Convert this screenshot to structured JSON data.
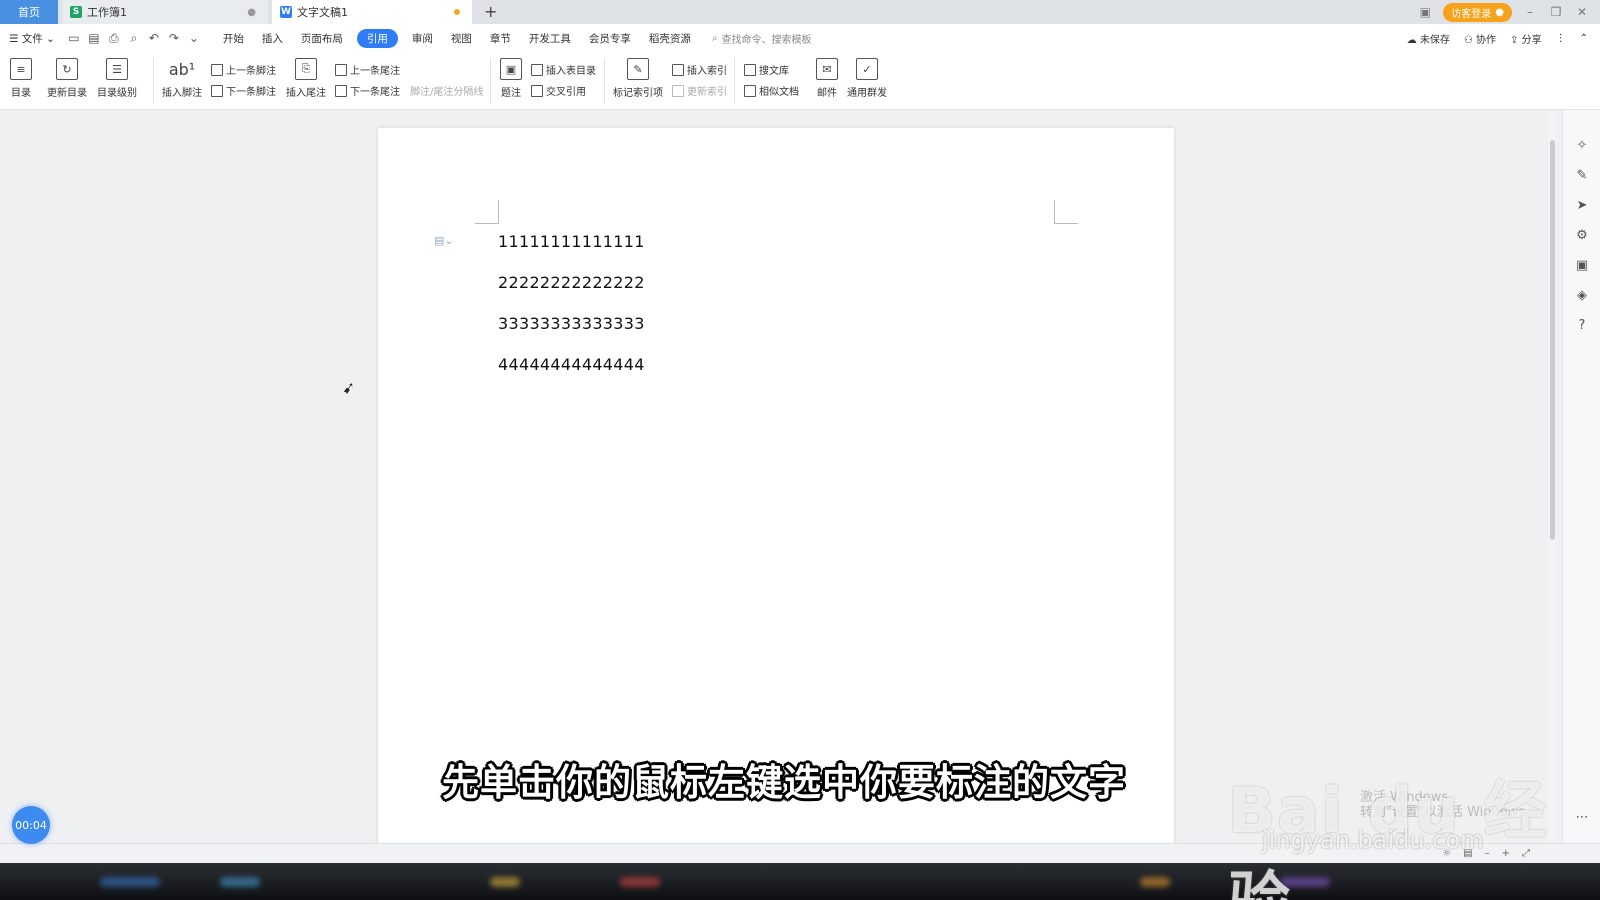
{
  "tabs": {
    "home": "首页",
    "workbook": "工作簿1",
    "document": "文字文稿1"
  },
  "topbar": {
    "login": "访客登录"
  },
  "menu": {
    "file": "文件",
    "items": [
      "开始",
      "插入",
      "页面布局",
      "引用",
      "审阅",
      "视图",
      "章节",
      "开发工具",
      "会员专享",
      "稻壳资源"
    ],
    "active": "引用",
    "search_placeholder": "查找命令、搜索模板",
    "unsaved": "未保存",
    "collab": "协作",
    "share": "分享"
  },
  "ribbon": {
    "toc": "目录",
    "update_toc": "更新目录",
    "toc_level": "目录级别",
    "insert_footnote": "插入脚注",
    "prev_footnote": "上一条脚注",
    "next_footnote": "下一条脚注",
    "insert_endnote": "插入尾注",
    "prev_endnote": "上一条尾注",
    "next_endnote": "下一条尾注",
    "separator": "脚注/尾注分隔线",
    "caption": "题注",
    "insert_table_toc": "插入表目录",
    "cross_ref": "交叉引用",
    "mark_index": "标记索引项",
    "insert_index": "插入索引",
    "update_index": "更新索引",
    "search_lib": "搜文库",
    "similar_docs": "相似文档",
    "mail": "邮件",
    "mass_send": "通用群发"
  },
  "document": {
    "lines": [
      "11111111111111",
      "22222222222222",
      "33333333333333",
      "44444444444444"
    ]
  },
  "overlay": {
    "timer": "00:04",
    "subtitle": "先单击你的鼠标左键选中你要标注的文字",
    "watermark": "Bai du 经验",
    "watermark_url": "jingyan.baidu.com",
    "activate_title": "激活 Windows",
    "activate_hint": "转到\"设置\"以激活 Windows。"
  },
  "colors": {
    "accent": "#2f7cf6",
    "home_tab": "#4a90e2",
    "login": "#f7a21b"
  }
}
